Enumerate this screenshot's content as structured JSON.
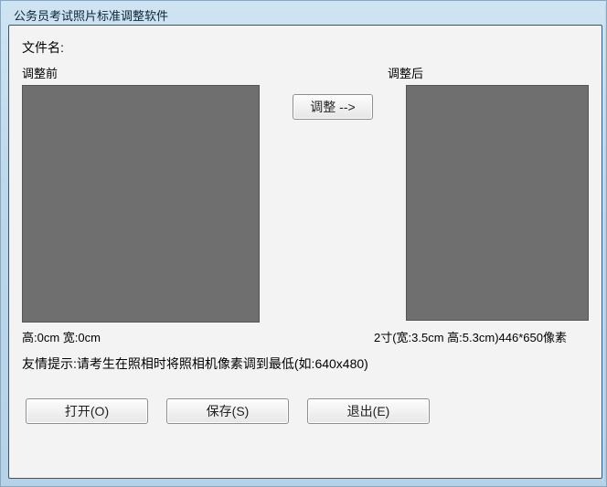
{
  "window": {
    "title": "公务员考试照片标准调整软件"
  },
  "labels": {
    "filename": "文件名:",
    "before": "调整前",
    "after": "调整后"
  },
  "buttons": {
    "adjust": "调整 -->",
    "open": "打开(O)",
    "save": "保存(S)",
    "exit": "退出(E)"
  },
  "dims": {
    "before": "高:0cm  宽:0cm",
    "after": "2寸(宽:3.5cm 高:5.3cm)446*650像素"
  },
  "hint": "友情提示:请考生在照相时将照相机像素调到最低(如:640x480)"
}
